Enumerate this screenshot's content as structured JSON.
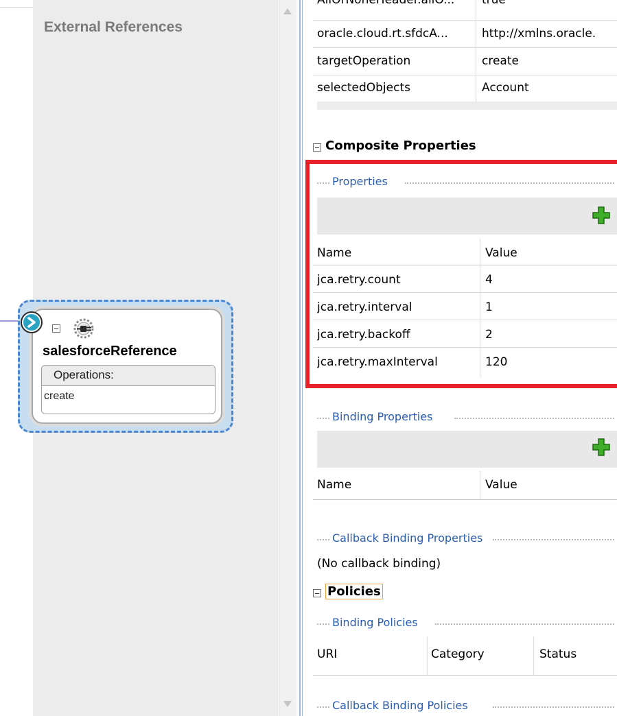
{
  "canvas": {
    "external_references_title": "External References",
    "reference": {
      "name": "salesforceReference",
      "operations_label": "Operations:",
      "operations": [
        "create"
      ]
    }
  },
  "properties_panel": {
    "top_rows": [
      {
        "name": "AllOrNoneHeader.allO...",
        "value": "true"
      },
      {
        "name": "oracle.cloud.rt.sfdcA...",
        "value": "http://xmlns.oracle."
      },
      {
        "name": "targetOperation",
        "value": "create"
      },
      {
        "name": "selectedObjects",
        "value": "Account"
      }
    ],
    "composite_properties": {
      "title": "Composite Properties",
      "properties": {
        "group_title": "Properties",
        "headers": {
          "name": "Name",
          "value": "Value"
        },
        "rows": [
          {
            "name": "jca.retry.count",
            "value": "4"
          },
          {
            "name": "jca.retry.interval",
            "value": "1"
          },
          {
            "name": "jca.retry.backoff",
            "value": "2"
          },
          {
            "name": "jca.retry.maxInterval",
            "value": "120"
          }
        ]
      },
      "binding_properties": {
        "group_title": "Binding Properties",
        "headers": {
          "name": "Name",
          "value": "Value"
        }
      },
      "callback_binding_properties": {
        "group_title": "Callback Binding Properties",
        "empty_text": "(No callback binding)"
      }
    },
    "policies": {
      "title": "Policies",
      "binding_policies": {
        "group_title": "Binding Policies",
        "headers": {
          "uri": "URI",
          "category": "Category",
          "status": "Status"
        }
      },
      "callback_binding_policies": {
        "group_title": "Callback Binding Policies"
      }
    }
  },
  "colors": {
    "highlight_border": "#e8202a",
    "group_title": "#2a5db0",
    "plus_icon": "#3fae2a",
    "reference_dash": "#4a86d1",
    "policies_focus": "#f0a030"
  },
  "icons": [
    "chevron-right-icon",
    "collapse-icon",
    "gear-plug-icon",
    "add-icon",
    "scroll-up-arrow-icon",
    "scroll-down-arrow-icon"
  ]
}
